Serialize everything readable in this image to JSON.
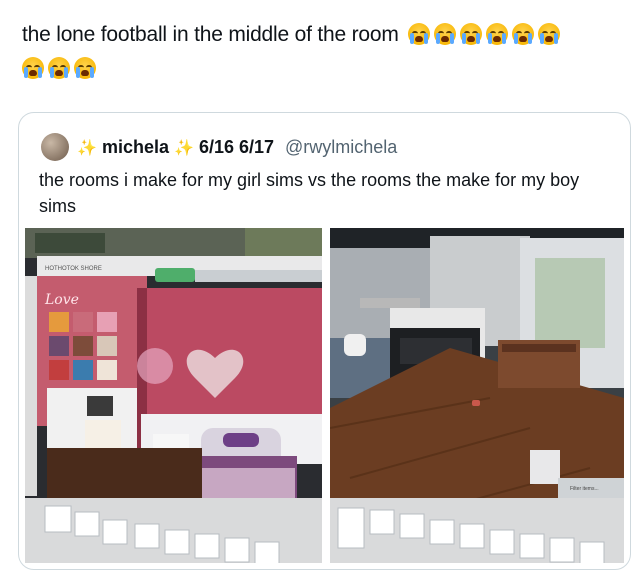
{
  "post": {
    "text": "the lone football in the middle of the room",
    "emojis": [
      "loudly-crying-face-icon",
      "loudly-crying-face-icon",
      "loudly-crying-face-icon",
      "loudly-crying-face-icon",
      "loudly-crying-face-icon",
      "loudly-crying-face-icon",
      "loudly-crying-face-icon",
      "loudly-crying-face-icon",
      "loudly-crying-face-icon"
    ]
  },
  "quote": {
    "name": "michela",
    "name_decoration": "✨",
    "dates": "6/16 6/17",
    "handle": "@rwylmichela",
    "text": "the rooms i make for my girl sims vs the rooms the make for my boy sims"
  },
  "left_image": {
    "sign_text": "HOTHOTOK SHORE",
    "wall_text": "Love"
  },
  "right_image": {
    "label_text": "Filter items..."
  },
  "colors": {
    "text": "#0f1419",
    "muted": "#536471",
    "border": "#cfd9de",
    "girl_wall": "#b9465e",
    "floor": "#4a2b1b"
  }
}
